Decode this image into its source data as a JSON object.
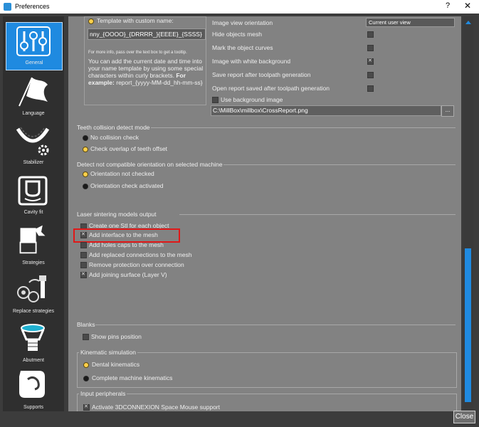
{
  "window": {
    "title": "Preferences",
    "help": "?",
    "close": "✕"
  },
  "sidebar": {
    "items": [
      {
        "label": "General",
        "icon": "sliders-icon",
        "active": true
      },
      {
        "label": "Language",
        "icon": "flag-icon"
      },
      {
        "label": "Stabilizer",
        "icon": "dental-arch-gear-icon"
      },
      {
        "label": "Cavity fit",
        "icon": "cavity-icon"
      },
      {
        "label": "Strategies",
        "icon": "strategies-icon"
      },
      {
        "label": "Replace strategies",
        "icon": "replace-strategies-icon"
      },
      {
        "label": "Abutment",
        "icon": "abutment-icon"
      },
      {
        "label": "Supports",
        "icon": "supports-icon"
      }
    ]
  },
  "template": {
    "radio_label": "Template with custom name:",
    "input_value": "nny_{OOOO}_{DRRRR_}{EEEE}_{SSSS}",
    "help_small": "For more info, pass over the text box to get a tooltip.",
    "help_text": "You can add the current date and time into your name template by using some special characters within curly brackets.",
    "example_label": "For example:",
    "example_value": "report_{yyyy-MM-dd_hh-mm-ss}"
  },
  "report": {
    "orientation_label": "Image view orientation",
    "orientation_value": "Current user view",
    "hide_mesh": "Hide objects mesh",
    "mark_curves": "Mark the object curves",
    "white_bg": "Image with white background",
    "save_after": "Save report after toolpath generation",
    "open_after": "Open report saved after toolpath generation",
    "use_bg": "Use background image",
    "bg_path": "C:\\MillBox\\millbox\\CrossReport.png",
    "browse": "..."
  },
  "teeth_collision": {
    "title": "Teeth collision detect mode",
    "options": [
      "No collision check",
      "Check overlap of teeth offset"
    ],
    "selected": 1
  },
  "orientation_detect": {
    "title": "Detect not compatible orientation on selected machine",
    "options": [
      "Orientation not checked",
      "Orientation check activated"
    ],
    "selected": 0
  },
  "laser": {
    "title": "Laser sintering models output",
    "items": [
      {
        "label": "Create one Stl for each object",
        "checked": false
      },
      {
        "label": "Add interface to the mesh",
        "checked": true
      },
      {
        "label": "Add holes caps to the mesh",
        "checked": false
      },
      {
        "label": "Add replaced connections to the mesh",
        "checked": false
      },
      {
        "label": "Remove protection over connection",
        "checked": false
      },
      {
        "label": "Add joining surface (Layer V)",
        "checked": true
      }
    ]
  },
  "blanks": {
    "title": "Blanks",
    "show_pins": "Show pins position"
  },
  "kinematic": {
    "title": "Kinematic simulation",
    "options": [
      "Dental kinematics",
      "Complete machine kinematics"
    ],
    "selected": 0
  },
  "input": {
    "title": "Input peripherals",
    "item": "Activate 3DCONNEXION Space Mouse support"
  },
  "footer": {
    "close": "Close"
  },
  "colors": {
    "accent": "#1f8ae0",
    "highlight": "#e01818",
    "radio_on": "#ffd04a"
  }
}
